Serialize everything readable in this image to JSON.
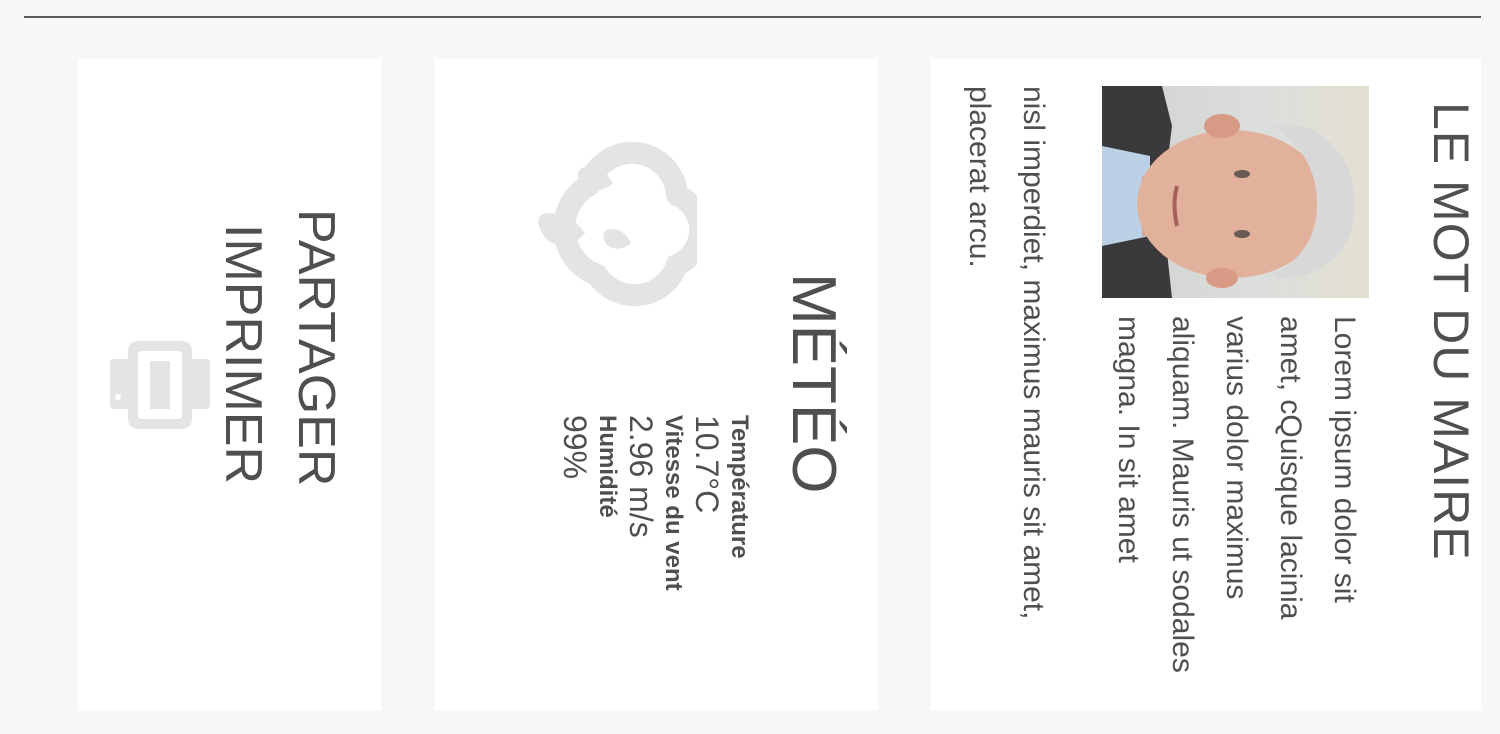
{
  "maire": {
    "title": "LE MOT DU MAIRE",
    "text_part1": "Lorem ipsum dolor sit amet, cQuisque lacinia varius dolor maximus aliquam. Mauris ut sodales magna. In sit amet",
    "text_part2": "nisl imperdiet, maximus mauris sit amet, placerat arcu."
  },
  "meteo": {
    "title": "MÉTÉO",
    "icon": "rain-cloud-icon",
    "rows": [
      {
        "label": "Température",
        "value": "10.7°C"
      },
      {
        "label": "Vitesse du vent",
        "value": "2.96 m/s"
      },
      {
        "label": "Humidité",
        "value": "99%"
      }
    ]
  },
  "actions": {
    "share_label": "PARTAGER",
    "print_label": "IMPRIMER",
    "print_icon": "printer-icon"
  },
  "colors": {
    "text": "#4f4f4f",
    "icon": "#e4e4e4",
    "panel": "#ffffff",
    "background": "#f7f7f7"
  }
}
